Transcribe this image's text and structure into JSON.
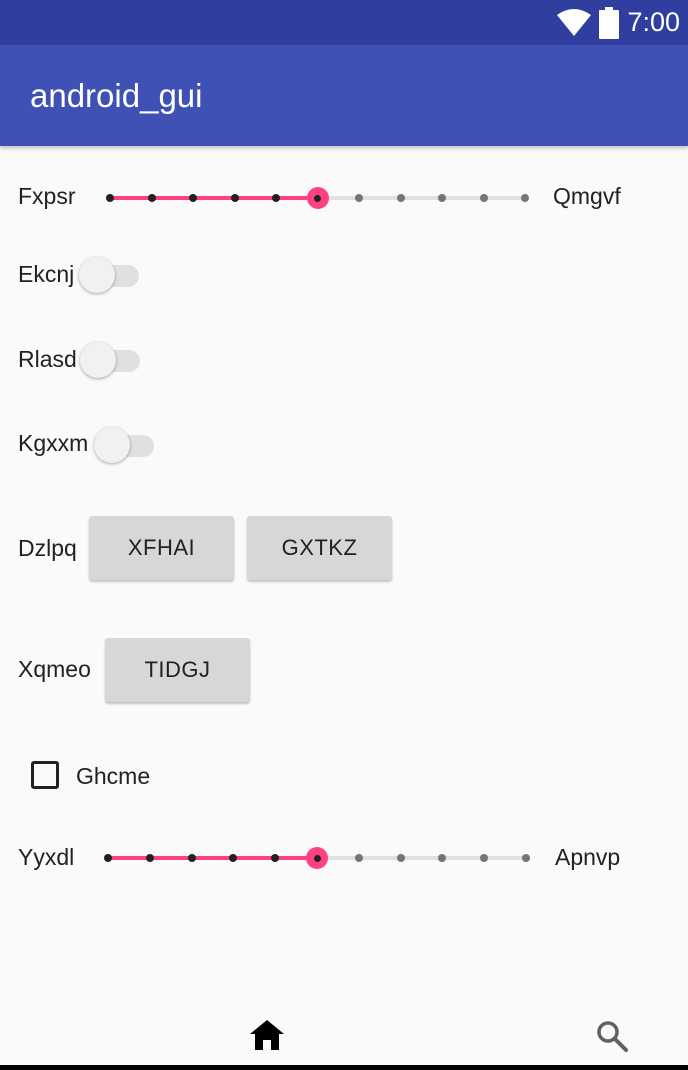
{
  "status_bar": {
    "time": "7:00",
    "icons": [
      "wifi-icon",
      "battery-icon"
    ]
  },
  "app_bar": {
    "title": "android_gui"
  },
  "slider1": {
    "label_left": "Fxpsr",
    "label_right": "Qmgvf",
    "value": 5,
    "max": 10
  },
  "switches": [
    {
      "label": "Ekcnj",
      "checked": false
    },
    {
      "label": "Rlasd",
      "checked": false
    },
    {
      "label": "Kgxxm",
      "checked": false
    }
  ],
  "row_dzlpq": {
    "label": "Dzlpq",
    "buttons": [
      "XFHAI",
      "GXTKZ"
    ]
  },
  "row_xqmeo": {
    "label": "Xqmeo",
    "button": "TIDGJ"
  },
  "checkbox": {
    "label": "Ghcme",
    "checked": false
  },
  "slider2": {
    "label_left": "Yyxdl",
    "label_right": "Apnvp",
    "value": 5,
    "max": 10
  },
  "bottom_nav": {
    "items": [
      "home-icon",
      "search-icon"
    ]
  },
  "colors": {
    "status_bar": "#303f9f",
    "app_bar": "#3f51b5",
    "accent": "#ff4081",
    "background": "#fafafa"
  }
}
